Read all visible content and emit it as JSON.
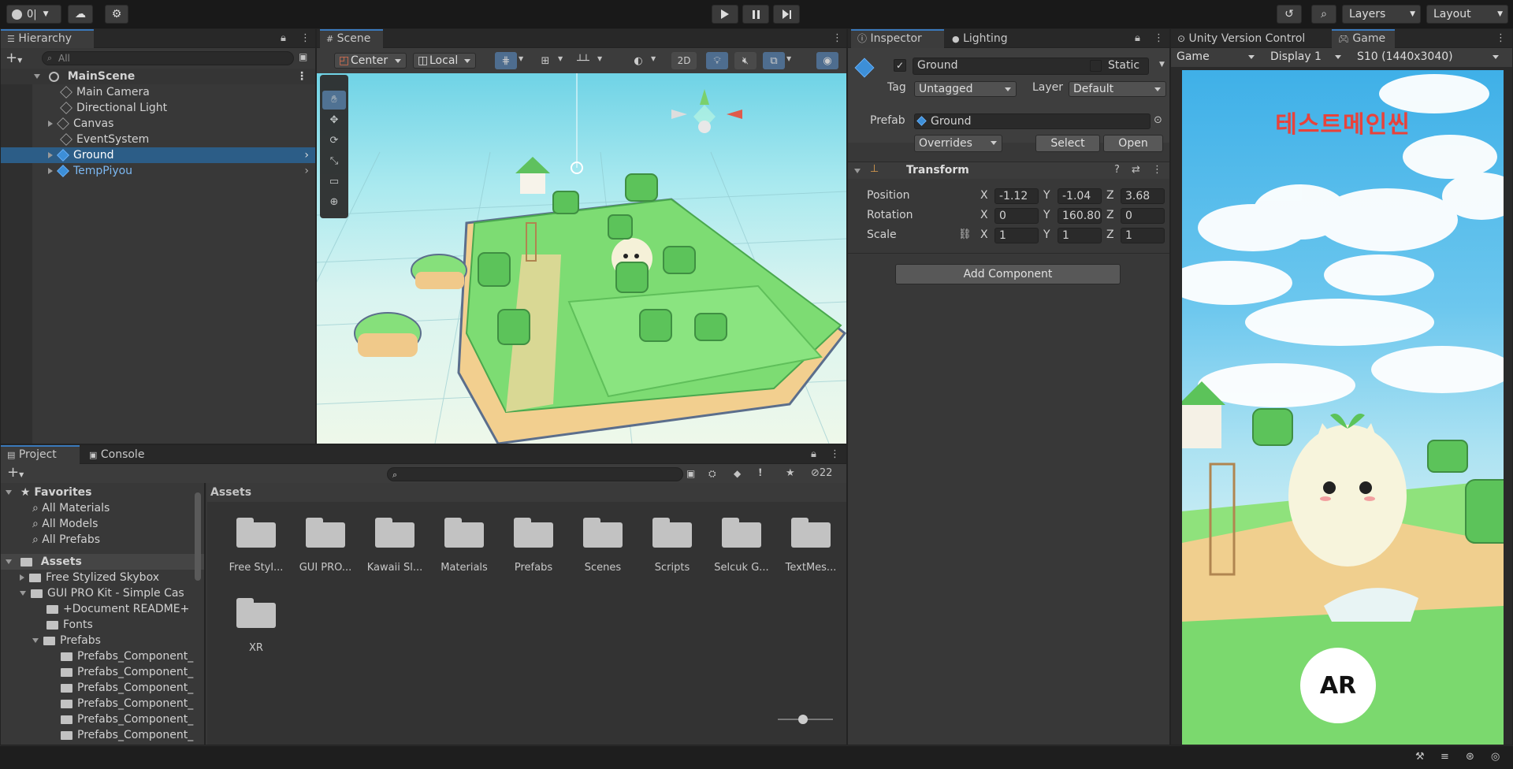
{
  "toolbar": {
    "account_label": "0|",
    "layers_label": "Layers",
    "layout_label": "Layout"
  },
  "hierarchy": {
    "tab_label": "Hierarchy",
    "search_placeholder": "All",
    "scene_name": "MainScene",
    "items": [
      {
        "label": "Main Camera"
      },
      {
        "label": "Directional Light"
      },
      {
        "label": "Canvas"
      },
      {
        "label": "EventSystem"
      },
      {
        "label": "Ground"
      },
      {
        "label": "TempPiyou"
      }
    ]
  },
  "scene": {
    "tab_label": "Scene",
    "pivot_label": "Center",
    "space_label": "Local",
    "mode_2d_label": "2D"
  },
  "inspector": {
    "tab_label": "Inspector",
    "lighting_tab_label": "Lighting",
    "object_name": "Ground",
    "static_label": "Static",
    "tag_label": "Tag",
    "tag_value": "Untagged",
    "layer_label": "Layer",
    "layer_value": "Default",
    "prefab_label": "Prefab",
    "prefab_value": "Ground",
    "overrides_label": "Overrides",
    "select_label": "Select",
    "open_label": "Open",
    "transform_label": "Transform",
    "position_label": "Position",
    "rotation_label": "Rotation",
    "scale_label": "Scale",
    "axis_x": "X",
    "axis_y": "Y",
    "axis_z": "Z",
    "position": {
      "x": "-1.12",
      "y": "-1.04",
      "z": "3.68"
    },
    "rotation": {
      "x": "0",
      "y": "160.80",
      "z": "0"
    },
    "scale": {
      "x": "1",
      "y": "1",
      "z": "1"
    },
    "add_component_label": "Add Component"
  },
  "game": {
    "vc_tab_label": "Unity Version Control",
    "tab_label": "Game",
    "view_label": "Game",
    "display_label": "Display 1",
    "resolution_label": "S10 (1440x3040)",
    "title_text": "테스트메인씬",
    "ar_button_label": "AR"
  },
  "project": {
    "tab_label": "Project",
    "console_tab_label": "Console",
    "hidden_count": "22",
    "favorites_label": "Favorites",
    "favorites": [
      "All Materials",
      "All Models",
      "All Prefabs"
    ],
    "assets_label": "Assets",
    "tree": [
      {
        "label": "Free Stylized Skybox",
        "depth": 1,
        "arrow": "right"
      },
      {
        "label": "GUI PRO Kit - Simple Cas",
        "depth": 1,
        "arrow": "down"
      },
      {
        "label": "+Document README+",
        "depth": 2,
        "arrow": ""
      },
      {
        "label": "Fonts",
        "depth": 2,
        "arrow": ""
      },
      {
        "label": "Prefabs",
        "depth": 2,
        "arrow": "down"
      },
      {
        "label": "Prefabs_Component_",
        "depth": 3,
        "arrow": ""
      },
      {
        "label": "Prefabs_Component_",
        "depth": 3,
        "arrow": ""
      },
      {
        "label": "Prefabs_Component_",
        "depth": 3,
        "arrow": ""
      },
      {
        "label": "Prefabs_Component_",
        "depth": 3,
        "arrow": ""
      },
      {
        "label": "Prefabs_Component_",
        "depth": 3,
        "arrow": ""
      },
      {
        "label": "Prefabs_Component_",
        "depth": 3,
        "arrow": ""
      }
    ],
    "breadcrumb": "Assets",
    "folders": [
      "Free Styl...",
      "GUI PRO...",
      "Kawaii Sl...",
      "Materials",
      "Prefabs",
      "Scenes",
      "Scripts",
      "Selcuk G...",
      "TextMes...",
      "XR"
    ]
  },
  "colors": {
    "accent": "#3a79bb",
    "selection": "#2c5d87",
    "panel_bg": "#383838",
    "title_red": "#e8423b"
  }
}
